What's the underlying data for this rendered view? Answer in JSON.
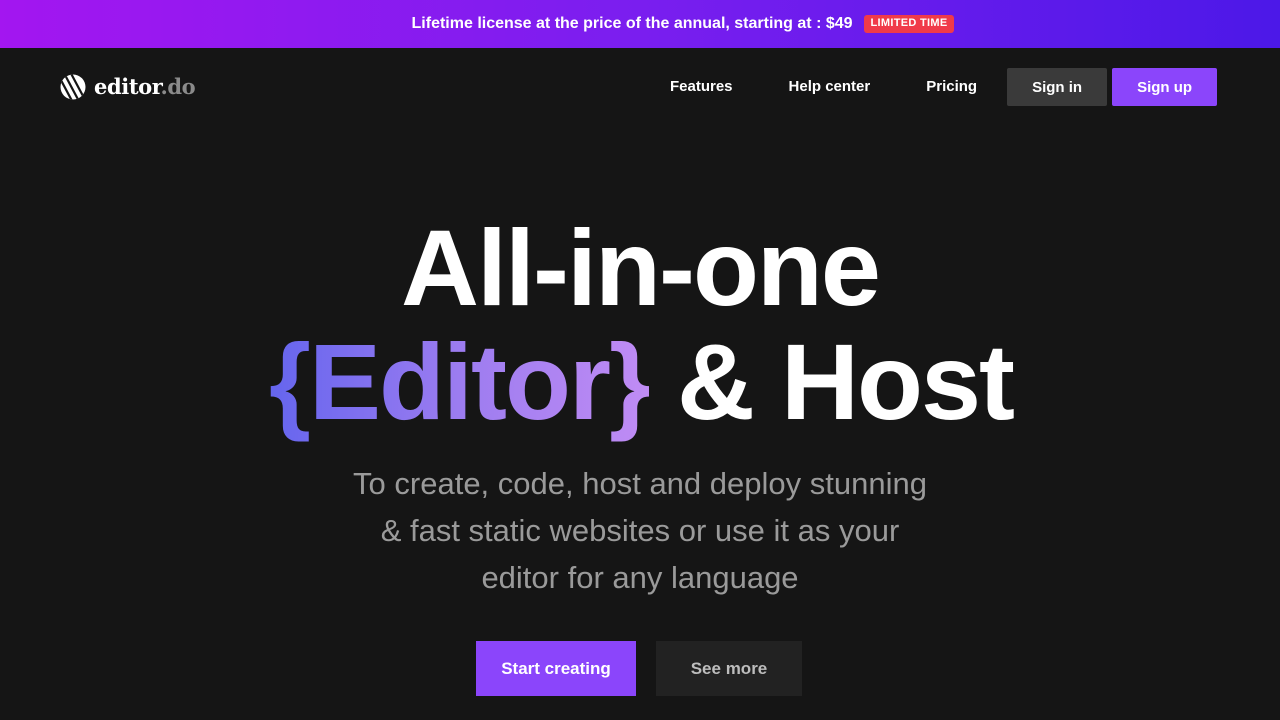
{
  "promo": {
    "text": "Lifetime license at the price of the annual, starting at : $49",
    "badge": "LIMITED TIME"
  },
  "header": {
    "logo": {
      "name": "editor",
      "tld": ".do",
      "icon": "editor-logo-icon"
    },
    "nav": [
      "Features",
      "Help center",
      "Pricing"
    ],
    "sign_in": "Sign in",
    "sign_up": "Sign up"
  },
  "hero": {
    "title_line1": "All-in-one",
    "title_highlight": "{Editor}",
    "title_rest": " & Host",
    "subtitle": "To create, code, host and deploy stunning & fast static websites or use it as your editor for any language",
    "primary_cta": "Start creating",
    "secondary_cta": "See more"
  },
  "colors": {
    "background": "#151515",
    "accent": "#8b45fb",
    "promo_gradient": [
      "#a316f0",
      "#4c18e8"
    ],
    "badge": "#f03a4a",
    "highlight_gradient": [
      "#6565ee",
      "#c08cf4"
    ]
  }
}
